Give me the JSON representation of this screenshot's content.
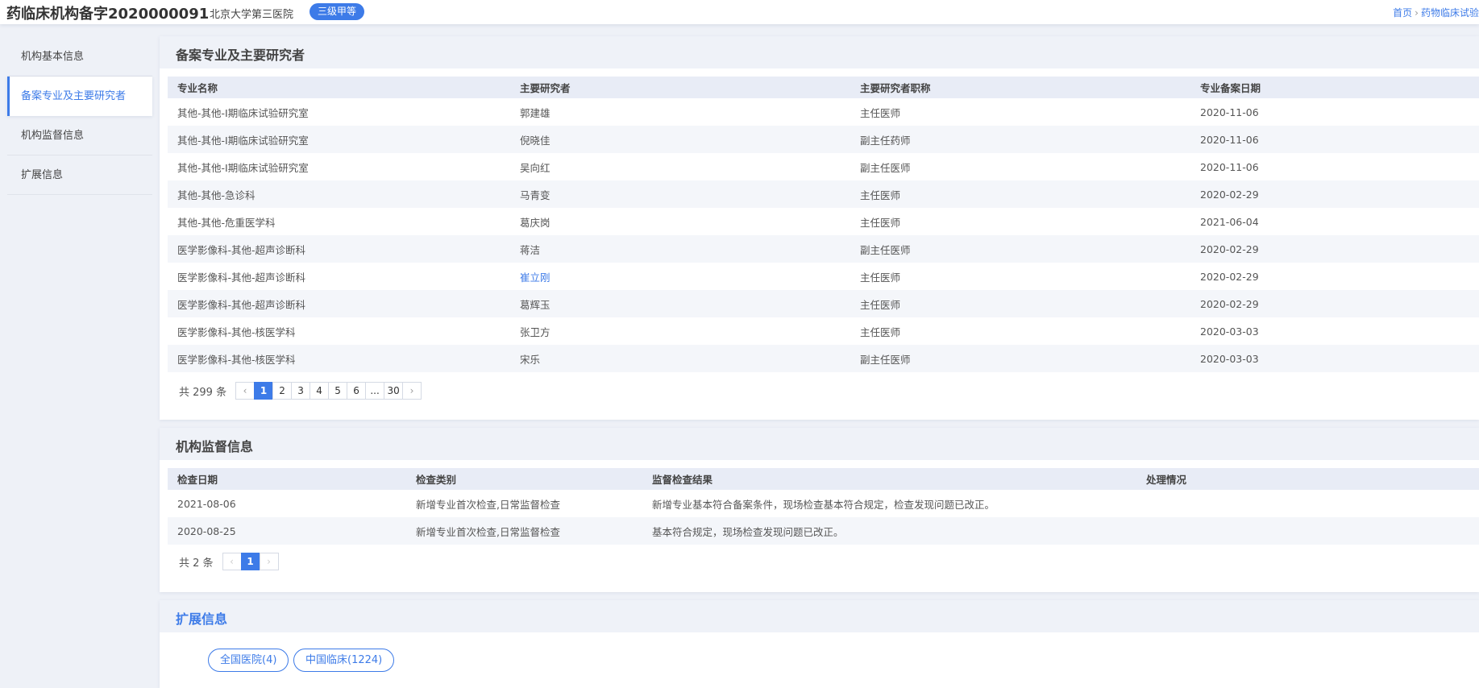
{
  "header": {
    "title": "药临床机构备字2020000091",
    "hospital": "北京大学第三医院",
    "grade": "三级甲等",
    "breadcrumb": [
      "首页",
      "药物临床试验"
    ]
  },
  "sidebar": {
    "items": [
      {
        "label": "机构基本信息"
      },
      {
        "label": "备案专业及主要研究者"
      },
      {
        "label": "机构监督信息"
      },
      {
        "label": "扩展信息"
      }
    ],
    "active_index": 1
  },
  "investigators": {
    "title": "备案专业及主要研究者",
    "columns": [
      "专业名称",
      "主要研究者",
      "主要研究者职称",
      "专业备案日期"
    ],
    "rows": [
      {
        "specialty": "其他-其他-I期临床试验研究室",
        "name": "郭建雄",
        "position": "主任医师",
        "date": "2020-11-06"
      },
      {
        "specialty": "其他-其他-I期临床试验研究室",
        "name": "倪晓佳",
        "position": "副主任药师",
        "date": "2020-11-06"
      },
      {
        "specialty": "其他-其他-I期临床试验研究室",
        "name": "吴向红",
        "position": "副主任医师",
        "date": "2020-11-06"
      },
      {
        "specialty": "其他-其他-急诊科",
        "name": "马青变",
        "position": "主任医师",
        "date": "2020-02-29"
      },
      {
        "specialty": "其他-其他-危重医学科",
        "name": "葛庆岗",
        "position": "主任医师",
        "date": "2021-06-04"
      },
      {
        "specialty": "医学影像科-其他-超声诊断科",
        "name": "蒋洁",
        "position": "副主任医师",
        "date": "2020-02-29"
      },
      {
        "specialty": "医学影像科-其他-超声诊断科",
        "name": "崔立刚",
        "position": "主任医师",
        "date": "2020-02-29"
      },
      {
        "specialty": "医学影像科-其他-超声诊断科",
        "name": "葛辉玉",
        "position": "主任医师",
        "date": "2020-02-29"
      },
      {
        "specialty": "医学影像科-其他-核医学科",
        "name": "张卫方",
        "position": "主任医师",
        "date": "2020-03-03"
      },
      {
        "specialty": "医学影像科-其他-核医学科",
        "name": "宋乐",
        "position": "副主任医师",
        "date": "2020-03-03"
      }
    ],
    "pagination": {
      "total": "共 299 条",
      "pages": [
        "1",
        "2",
        "3",
        "4",
        "5",
        "6",
        "...",
        "30"
      ],
      "current": "1"
    }
  },
  "supervision": {
    "title": "机构监督信息",
    "columns": [
      "检查日期",
      "检查类别",
      "监督检查结果",
      "处理情况"
    ],
    "rows": [
      {
        "date": "2021-08-06",
        "type": "新增专业首次检查,日常监督检查",
        "result": "新增专业基本符合备案条件，现场检查基本符合规定，检查发现问题已改正。",
        "handling": ""
      },
      {
        "date": "2020-08-25",
        "type": "新增专业首次检查,日常监督检查",
        "result": "基本符合规定，现场检查发现问题已改正。",
        "handling": ""
      }
    ],
    "pagination": {
      "total": "共 2 条",
      "pages": [
        "1"
      ],
      "current": "1"
    }
  },
  "extension": {
    "title": "扩展信息",
    "tags": [
      "全国医院(4)",
      "中国临床(1224)"
    ]
  },
  "colors": {
    "accent": "#3d7be8",
    "background": "#eef1f7",
    "table_header": "#e8ecf6",
    "row_alt": "#f4f6fa"
  }
}
